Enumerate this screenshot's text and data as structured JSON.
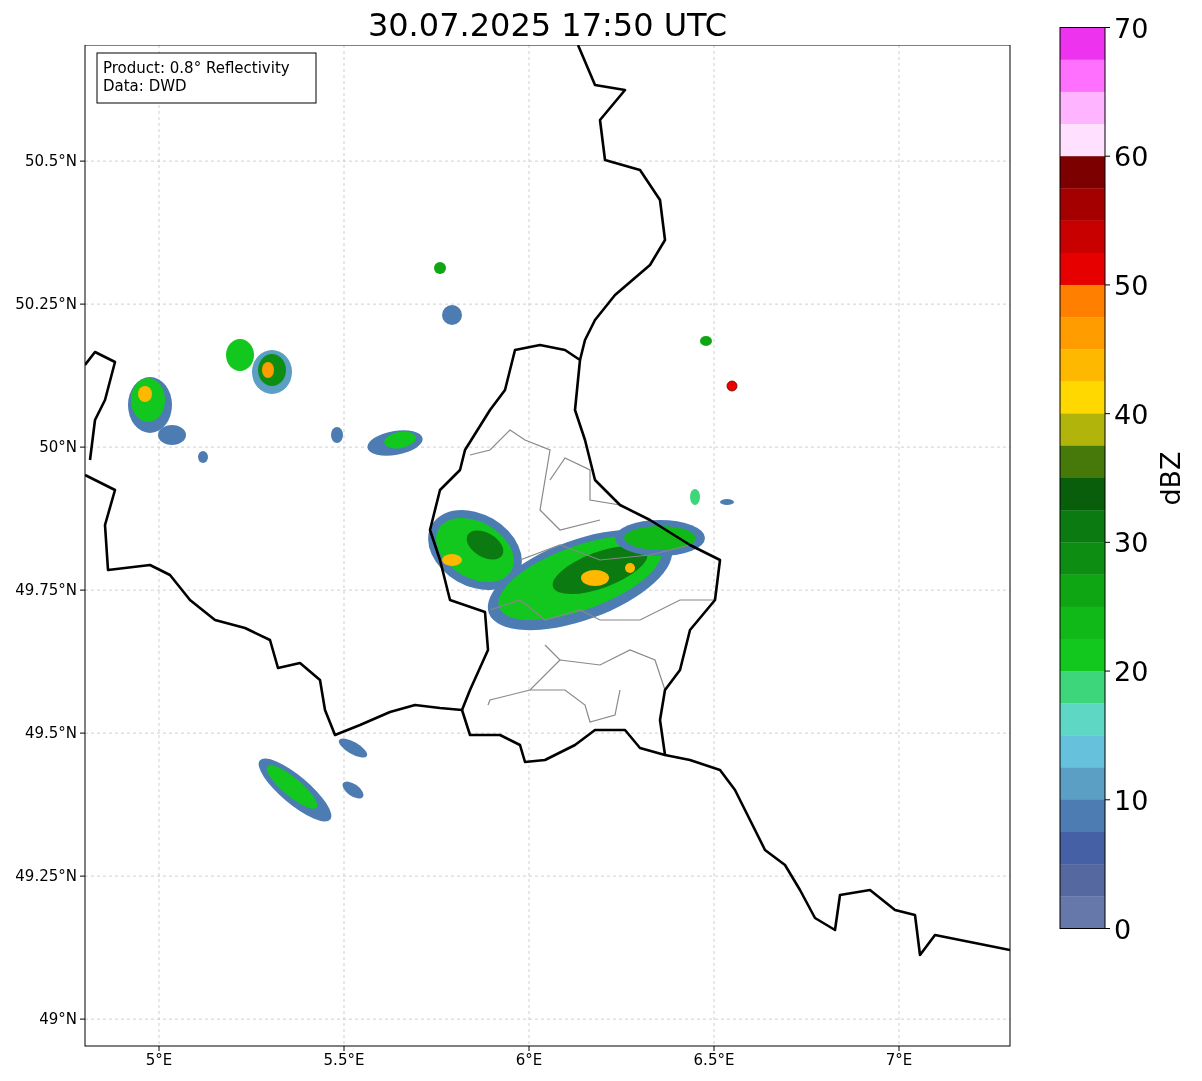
{
  "title": "30.07.2025 17:50 UTC",
  "info_box": {
    "lines": [
      "Product: 0.8° Reflectivity",
      "Data: DWD"
    ]
  },
  "map": {
    "x_ticks": [
      "5°E",
      "5.5°E",
      "6°E",
      "6.5°E",
      "7°E"
    ],
    "y_ticks": [
      "50.5°N",
      "50.25°N",
      "50°N",
      "49.75°N",
      "49.5°N",
      "49.25°N",
      "49°N"
    ]
  },
  "colorbar": {
    "label": "dBZ",
    "ticks": [
      "70",
      "60",
      "50",
      "40",
      "30",
      "20",
      "10",
      "0"
    ],
    "bands": [
      {
        "color": "#ee33ee"
      },
      {
        "color": "#ff70ff"
      },
      {
        "color": "#ffb4ff"
      },
      {
        "color": "#ffe0ff"
      },
      {
        "color": "#7d0000"
      },
      {
        "color": "#a50000"
      },
      {
        "color": "#c80000"
      },
      {
        "color": "#e60000"
      },
      {
        "color": "#ff8000"
      },
      {
        "color": "#ff9c00"
      },
      {
        "color": "#ffb800"
      },
      {
        "color": "#ffd800"
      },
      {
        "color": "#b1b40a"
      },
      {
        "color": "#46780a"
      },
      {
        "color": "#085e0b"
      },
      {
        "color": "#0b7a10"
      },
      {
        "color": "#0d8e12"
      },
      {
        "color": "#0fa614"
      },
      {
        "color": "#10b818"
      },
      {
        "color": "#12c81e"
      },
      {
        "color": "#3ed67a"
      },
      {
        "color": "#5ed8c4"
      },
      {
        "color": "#66c2dc"
      },
      {
        "color": "#5b9fc5"
      },
      {
        "color": "#4d7cb3"
      },
      {
        "color": "#4560a4"
      },
      {
        "color": "#5568a0"
      },
      {
        "color": "#6677aa"
      }
    ]
  }
}
